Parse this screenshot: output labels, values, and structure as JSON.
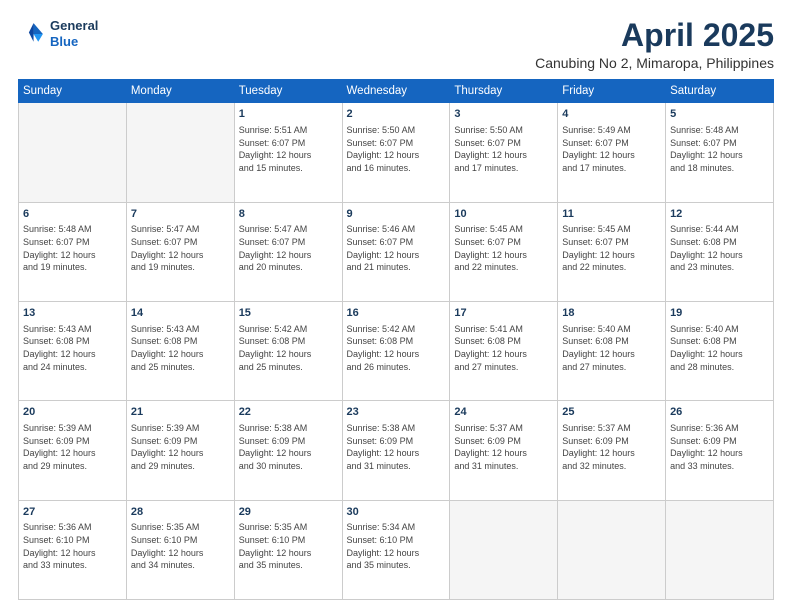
{
  "header": {
    "logo_line1": "General",
    "logo_line2": "Blue",
    "title": "April 2025",
    "subtitle": "Canubing No 2, Mimaropa, Philippines"
  },
  "weekdays": [
    "Sunday",
    "Monday",
    "Tuesday",
    "Wednesday",
    "Thursday",
    "Friday",
    "Saturday"
  ],
  "weeks": [
    [
      {
        "day": "",
        "info": ""
      },
      {
        "day": "",
        "info": ""
      },
      {
        "day": "1",
        "info": "Sunrise: 5:51 AM\nSunset: 6:07 PM\nDaylight: 12 hours\nand 15 minutes."
      },
      {
        "day": "2",
        "info": "Sunrise: 5:50 AM\nSunset: 6:07 PM\nDaylight: 12 hours\nand 16 minutes."
      },
      {
        "day": "3",
        "info": "Sunrise: 5:50 AM\nSunset: 6:07 PM\nDaylight: 12 hours\nand 17 minutes."
      },
      {
        "day": "4",
        "info": "Sunrise: 5:49 AM\nSunset: 6:07 PM\nDaylight: 12 hours\nand 17 minutes."
      },
      {
        "day": "5",
        "info": "Sunrise: 5:48 AM\nSunset: 6:07 PM\nDaylight: 12 hours\nand 18 minutes."
      }
    ],
    [
      {
        "day": "6",
        "info": "Sunrise: 5:48 AM\nSunset: 6:07 PM\nDaylight: 12 hours\nand 19 minutes."
      },
      {
        "day": "7",
        "info": "Sunrise: 5:47 AM\nSunset: 6:07 PM\nDaylight: 12 hours\nand 19 minutes."
      },
      {
        "day": "8",
        "info": "Sunrise: 5:47 AM\nSunset: 6:07 PM\nDaylight: 12 hours\nand 20 minutes."
      },
      {
        "day": "9",
        "info": "Sunrise: 5:46 AM\nSunset: 6:07 PM\nDaylight: 12 hours\nand 21 minutes."
      },
      {
        "day": "10",
        "info": "Sunrise: 5:45 AM\nSunset: 6:07 PM\nDaylight: 12 hours\nand 22 minutes."
      },
      {
        "day": "11",
        "info": "Sunrise: 5:45 AM\nSunset: 6:07 PM\nDaylight: 12 hours\nand 22 minutes."
      },
      {
        "day": "12",
        "info": "Sunrise: 5:44 AM\nSunset: 6:08 PM\nDaylight: 12 hours\nand 23 minutes."
      }
    ],
    [
      {
        "day": "13",
        "info": "Sunrise: 5:43 AM\nSunset: 6:08 PM\nDaylight: 12 hours\nand 24 minutes."
      },
      {
        "day": "14",
        "info": "Sunrise: 5:43 AM\nSunset: 6:08 PM\nDaylight: 12 hours\nand 25 minutes."
      },
      {
        "day": "15",
        "info": "Sunrise: 5:42 AM\nSunset: 6:08 PM\nDaylight: 12 hours\nand 25 minutes."
      },
      {
        "day": "16",
        "info": "Sunrise: 5:42 AM\nSunset: 6:08 PM\nDaylight: 12 hours\nand 26 minutes."
      },
      {
        "day": "17",
        "info": "Sunrise: 5:41 AM\nSunset: 6:08 PM\nDaylight: 12 hours\nand 27 minutes."
      },
      {
        "day": "18",
        "info": "Sunrise: 5:40 AM\nSunset: 6:08 PM\nDaylight: 12 hours\nand 27 minutes."
      },
      {
        "day": "19",
        "info": "Sunrise: 5:40 AM\nSunset: 6:08 PM\nDaylight: 12 hours\nand 28 minutes."
      }
    ],
    [
      {
        "day": "20",
        "info": "Sunrise: 5:39 AM\nSunset: 6:09 PM\nDaylight: 12 hours\nand 29 minutes."
      },
      {
        "day": "21",
        "info": "Sunrise: 5:39 AM\nSunset: 6:09 PM\nDaylight: 12 hours\nand 29 minutes."
      },
      {
        "day": "22",
        "info": "Sunrise: 5:38 AM\nSunset: 6:09 PM\nDaylight: 12 hours\nand 30 minutes."
      },
      {
        "day": "23",
        "info": "Sunrise: 5:38 AM\nSunset: 6:09 PM\nDaylight: 12 hours\nand 31 minutes."
      },
      {
        "day": "24",
        "info": "Sunrise: 5:37 AM\nSunset: 6:09 PM\nDaylight: 12 hours\nand 31 minutes."
      },
      {
        "day": "25",
        "info": "Sunrise: 5:37 AM\nSunset: 6:09 PM\nDaylight: 12 hours\nand 32 minutes."
      },
      {
        "day": "26",
        "info": "Sunrise: 5:36 AM\nSunset: 6:09 PM\nDaylight: 12 hours\nand 33 minutes."
      }
    ],
    [
      {
        "day": "27",
        "info": "Sunrise: 5:36 AM\nSunset: 6:10 PM\nDaylight: 12 hours\nand 33 minutes."
      },
      {
        "day": "28",
        "info": "Sunrise: 5:35 AM\nSunset: 6:10 PM\nDaylight: 12 hours\nand 34 minutes."
      },
      {
        "day": "29",
        "info": "Sunrise: 5:35 AM\nSunset: 6:10 PM\nDaylight: 12 hours\nand 35 minutes."
      },
      {
        "day": "30",
        "info": "Sunrise: 5:34 AM\nSunset: 6:10 PM\nDaylight: 12 hours\nand 35 minutes."
      },
      {
        "day": "",
        "info": ""
      },
      {
        "day": "",
        "info": ""
      },
      {
        "day": "",
        "info": ""
      }
    ]
  ]
}
